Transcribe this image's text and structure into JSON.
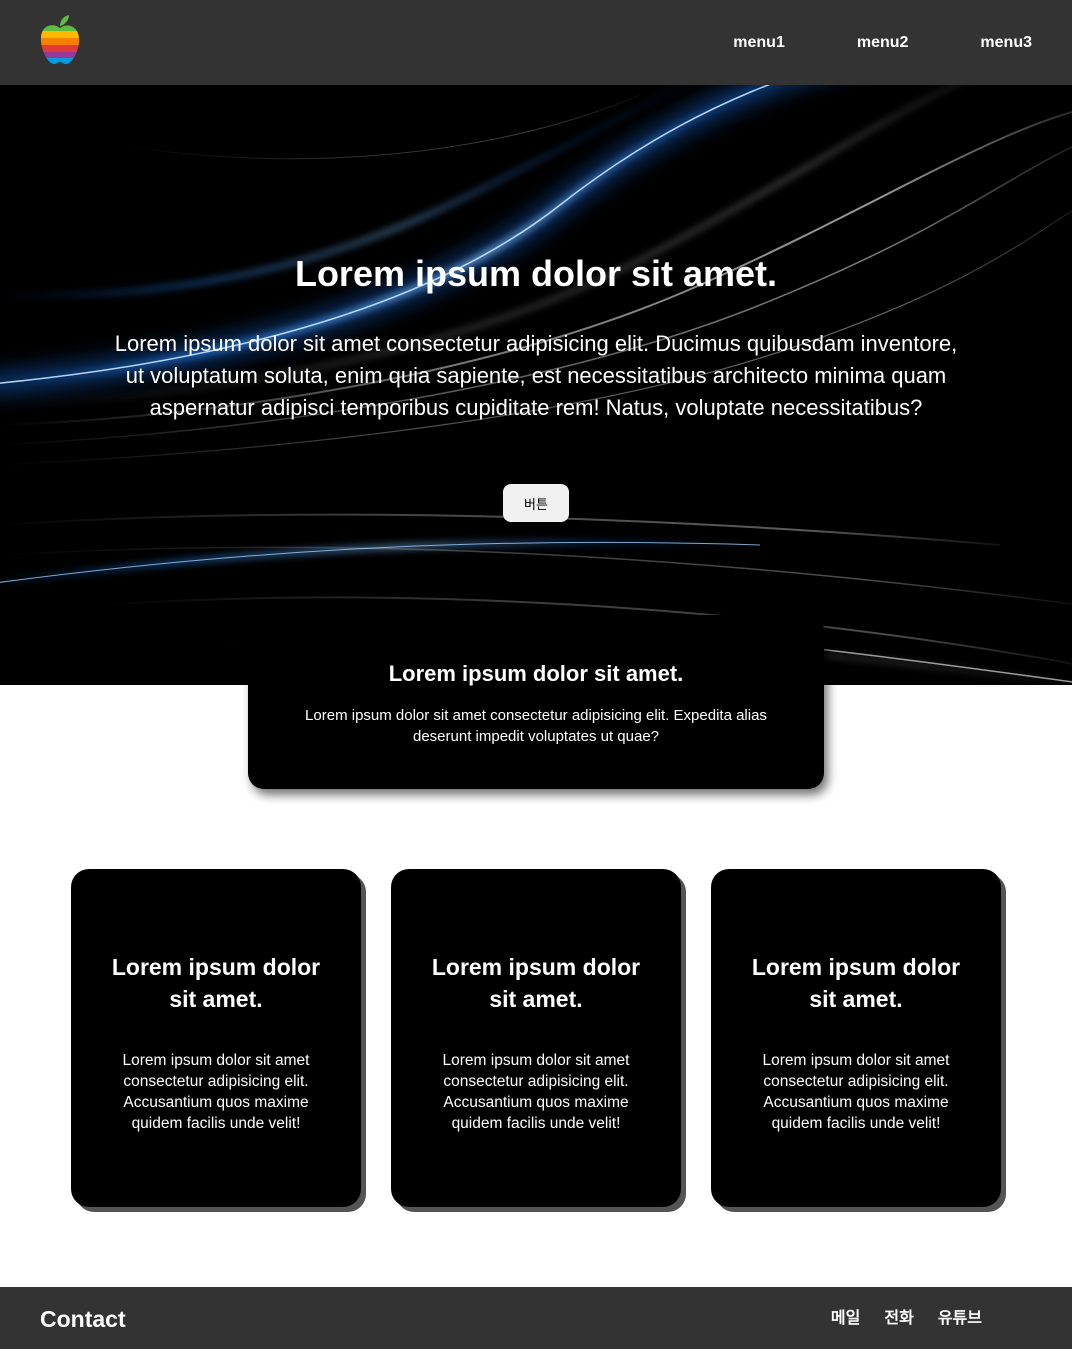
{
  "header": {
    "logo_name": "apple-rainbow-logo",
    "nav": [
      "menu1",
      "menu2",
      "menu3"
    ]
  },
  "hero": {
    "title": "Lorem ipsum dolor sit amet.",
    "text": "Lorem ipsum dolor sit amet consectetur adipisicing elit. Ducimus quibusdam inventore, ut voluptatum soluta, enim quia sapiente, est necessitatibus architecto minima quam aspernatur adipisci temporibus cupiditate rem! Natus, voluptate necessitatibus?",
    "button_label": "버튼"
  },
  "overlay_card": {
    "title": "Lorem ipsum dolor sit amet.",
    "text": "Lorem ipsum dolor sit amet consectetur adipisicing elit. Expedita alias deserunt impedit voluptates ut quae?"
  },
  "cards": [
    {
      "title": "Lorem ipsum dolor sit amet.",
      "text": "Lorem ipsum dolor sit amet consectetur adipisicing elit. Accusantium quos maxime quidem facilis unde velit!"
    },
    {
      "title": "Lorem ipsum dolor sit amet.",
      "text": "Lorem ipsum dolor sit amet consectetur adipisicing elit. Accusantium quos maxime quidem facilis unde velit!"
    },
    {
      "title": "Lorem ipsum dolor sit amet.",
      "text": "Lorem ipsum dolor sit amet consectetur adipisicing elit. Accusantium quos maxime quidem facilis unde velit!"
    }
  ],
  "footer": {
    "title": "Contact",
    "links": [
      "메일",
      "전화",
      "유튜브"
    ]
  },
  "colors": {
    "header_bg": "#333333",
    "card_bg": "#000000",
    "card_shadow": "#555555",
    "hero_streak": "#1e7bff"
  }
}
